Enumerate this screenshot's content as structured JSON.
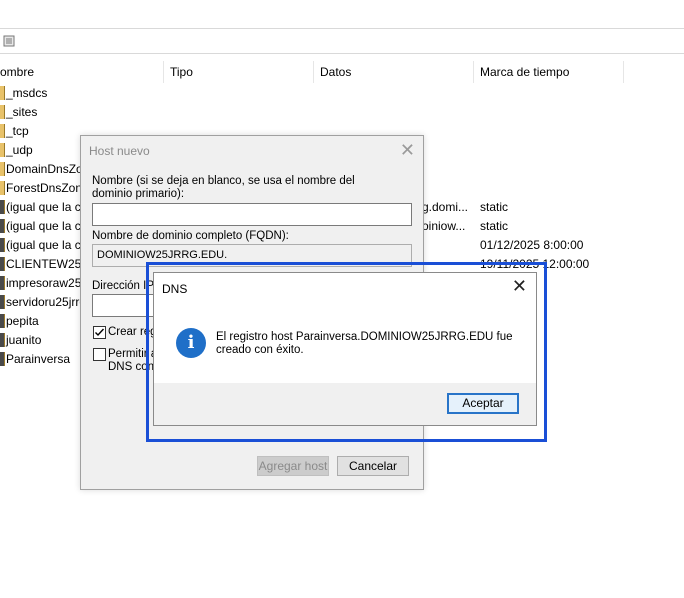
{
  "columns": [
    "ombre",
    "Tipo",
    "Datos",
    "Marca de tiempo"
  ],
  "rows": [
    {
      "name": "_msdcs",
      "type": "",
      "data": "",
      "time": "",
      "kind": "folder"
    },
    {
      "name": "_sites",
      "type": "",
      "data": "",
      "time": "",
      "kind": "folder"
    },
    {
      "name": "_tcp",
      "type": "",
      "data": "",
      "time": "",
      "kind": "folder"
    },
    {
      "name": "_udp",
      "type": "",
      "data": "",
      "time": "",
      "kind": "folder"
    },
    {
      "name": "DomainDnsZo",
      "type": "",
      "data": "",
      "time": "",
      "kind": "folder"
    },
    {
      "name": "ForestDnsZon",
      "type": "",
      "data": "",
      "time": "",
      "kind": "folder"
    },
    {
      "name": "(igual que la c",
      "type": "",
      "data": "g.domi...",
      "time": "static",
      "kind": "host"
    },
    {
      "name": "(igual que la c",
      "type": "",
      "data": "oiniow...",
      "time": "static",
      "kind": "host"
    },
    {
      "name": "(igual que la c",
      "type": "",
      "data": "",
      "time": "01/12/2025 8:00:00",
      "kind": "host"
    },
    {
      "name": "CLIENTEW25JF",
      "type": "",
      "data": "",
      "time": "19/11/2025 12:00:00",
      "kind": "host"
    },
    {
      "name": "impresoraw25",
      "type": "",
      "data": "",
      "time": "",
      "kind": "host"
    },
    {
      "name": "servidoru25jrrg",
      "type": "",
      "data": "",
      "time": "",
      "kind": "host"
    },
    {
      "name": "pepita",
      "type": "",
      "data": "",
      "time": "",
      "kind": "host"
    },
    {
      "name": "juanito",
      "type": "",
      "data": "",
      "time": "",
      "kind": "host"
    },
    {
      "name": "Parainversa",
      "type": "",
      "data": "",
      "time": "",
      "kind": "host"
    }
  ],
  "host_dialog": {
    "title": "Host nuevo",
    "name_label": "Nombre (si se deja en blanco, se usa el nombre del dominio primario):",
    "name_value": "",
    "fqdn_label": "Nombre de dominio completo (FQDN):",
    "fqdn_value": "DOMINIOW25JRRG.EDU.",
    "ip_label": "Dirección IP:",
    "ip_value": "",
    "create_ptr_label": "Crear reg",
    "allow_label_1": "Permitir a",
    "allow_label_2": "DNS con e",
    "create_ptr_checked": true,
    "allow_checked": false,
    "add_button": "Agregar host",
    "cancel_button": "Cancelar"
  },
  "dns_dialog": {
    "title": "DNS",
    "message": "El registro host Parainversa.DOMINIOW25JRRG.EDU fue creado con éxito.",
    "ok_button": "Aceptar",
    "close_glyph": "✕",
    "info_glyph": "i"
  },
  "colors": {
    "highlight": "#1a4fd6",
    "info": "#1f6fc8",
    "folder": "#e8c26a"
  }
}
